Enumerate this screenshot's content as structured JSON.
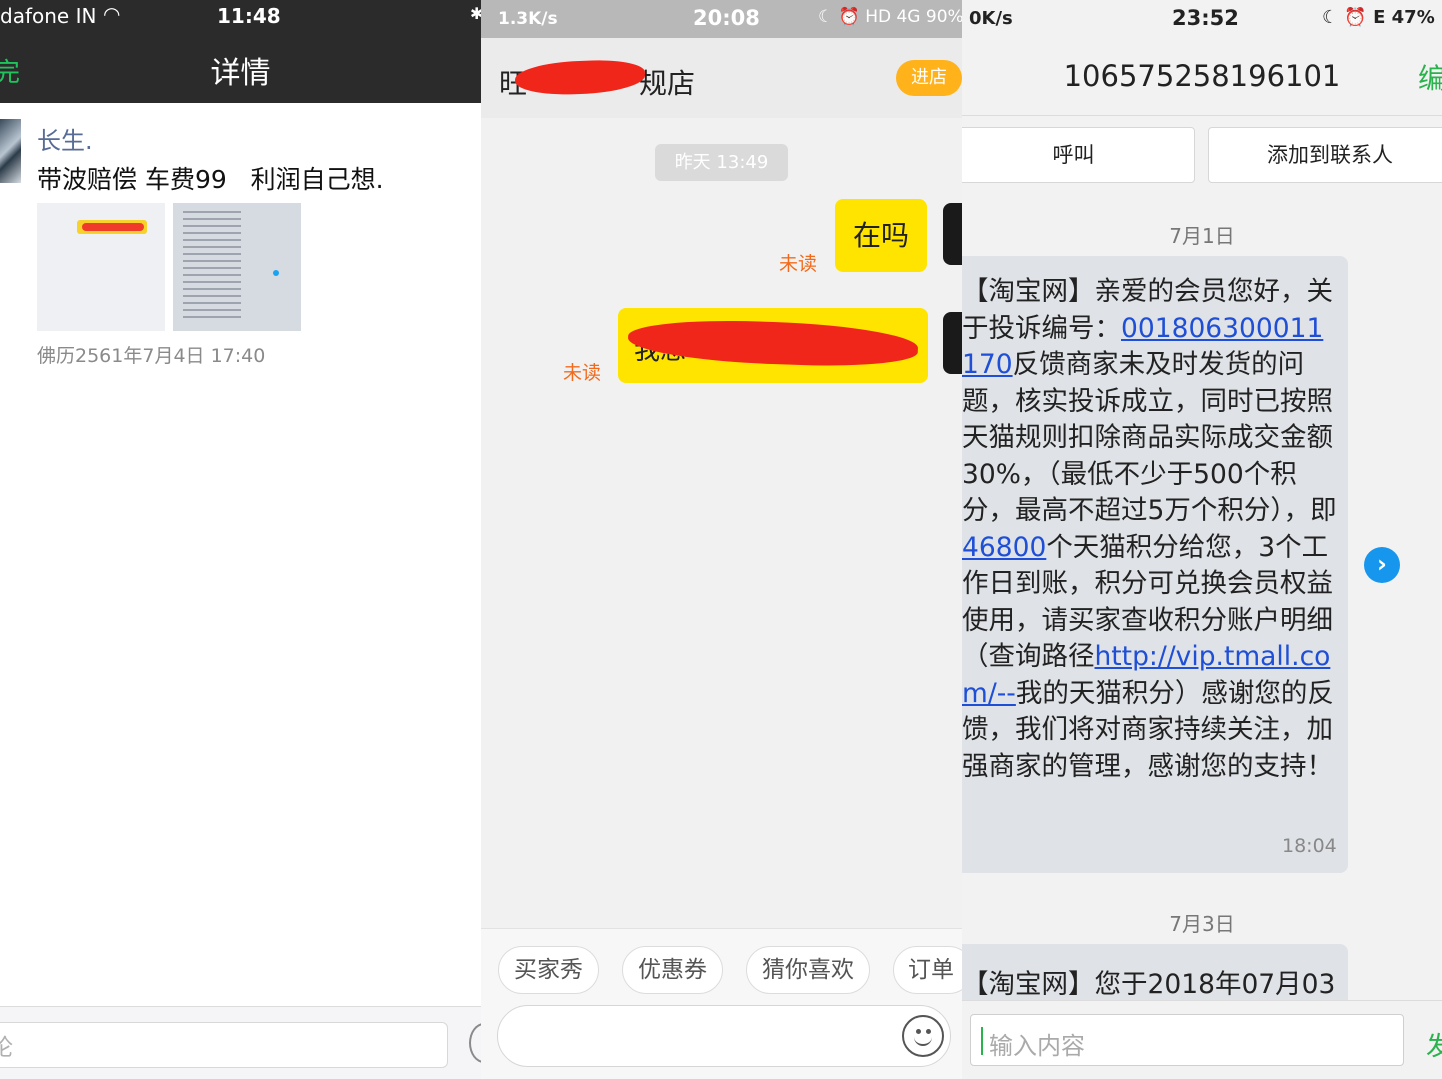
{
  "panel1": {
    "status": {
      "carrier": "dafone IN",
      "time": "11:48",
      "wifi_icon": "wifi-icon",
      "bluetooth_icon": "bluetooth-icon"
    },
    "nav": {
      "back_label": "完",
      "title": "详情"
    },
    "post": {
      "author": "长生.",
      "text": "带波赔偿 车费99   利润自己想.",
      "timestamp": "佛历2561年7月4日 17:40"
    },
    "comment": {
      "placeholder": "论"
    }
  },
  "panel2": {
    "status": {
      "speed": "1.3K/s",
      "time": "20:08",
      "indicators": "☾ ⏰ HD 4G 90%"
    },
    "header": {
      "shop_name": "旺　　　　规店",
      "enter_button": "进店"
    },
    "timestamp": "昨天 13:49",
    "messages": [
      {
        "text": "在吗",
        "status": "未读"
      },
      {
        "text": "我想　　　　能吗　",
        "status": "未读"
      }
    ],
    "quick_replies": [
      "买家秀",
      "优惠券",
      "猜你喜欢",
      "订单"
    ],
    "emoji_icon": "smile-icon",
    "colors": {
      "bubble": "#ffe400",
      "unread": "#f26b1d",
      "enter": "#ffb21a"
    }
  },
  "panel3": {
    "status": {
      "speed": "0K/s",
      "time": "23:52",
      "indicators": "☾ ⏰ E 47%"
    },
    "header": {
      "phone": "106575258196101",
      "edit": "编"
    },
    "actions": {
      "call": "呼叫",
      "add_contact": "添加到联系人"
    },
    "messages": [
      {
        "date": "7月1日",
        "intro": "【淘宝网】亲爱的会员您好，关于投诉编号：",
        "complaint_no": "001806300011170",
        "mid1": "反馈商家未及时发货的问题，核实投诉成立，同时已按照天猫规则扣除商品实际成交金额30%，（最低不少于500个积分，最高不超过5万个积分），即",
        "points": "46800",
        "mid2": "个天猫积分给您，3个工作日到账，积分可兑换会员权益使用，请买家查收积分账户明细（查询路径",
        "url": "http://vip.tmall.com/--",
        "outro": "我的天猫积分）感谢您的反馈，我们将对商家持续关注，加强商家的管理，感谢您的支持！",
        "time": "18:04"
      },
      {
        "date": "7月3日",
        "text": "【淘宝网】您于2018年07月03"
      }
    ],
    "input": {
      "placeholder": "输入内容",
      "send": "发"
    },
    "forward_icon": "chevron-right-icon",
    "colors": {
      "link": "#1e4fd6",
      "accent": "#2ab24c",
      "forward": "#1796ee"
    }
  }
}
